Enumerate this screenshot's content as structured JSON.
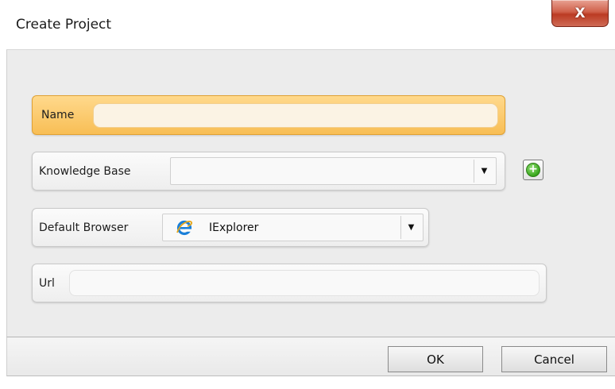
{
  "window": {
    "title": "Create Project",
    "close_glyph": "X"
  },
  "form": {
    "name": {
      "label": "Name",
      "value": ""
    },
    "knowledge_base": {
      "label": "Knowledge Base",
      "value": "",
      "add_glyph": "+"
    },
    "default_browser": {
      "label": "Default Browser",
      "value": "IExplorer",
      "icon": "internet-explorer-icon"
    },
    "url": {
      "label": "Url",
      "value": ""
    }
  },
  "buttons": {
    "ok_label": "OK",
    "cancel_label": "Cancel"
  },
  "colors": {
    "focus_accent": "#f8be55",
    "close_button": "#c7452d",
    "add_button": "#36a61a"
  }
}
